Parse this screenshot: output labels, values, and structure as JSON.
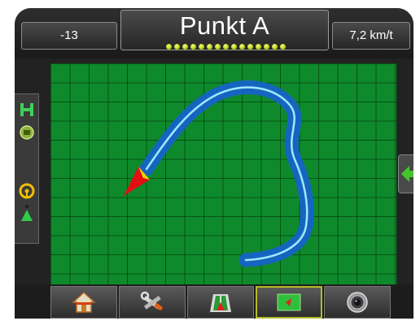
{
  "header": {
    "left_value": "-13",
    "title": "Punkt A",
    "right_value": "7,2 km/t",
    "indicator_count": 15,
    "indicator_color": "#c8e000"
  },
  "map": {
    "background_color": "#0e8a2c",
    "coverage_color": "#1565c0",
    "guideline_color": "#9fe8ff",
    "vehicle_color": "#e01010",
    "vehicle_accent": "#f2d200"
  },
  "sidebar": {
    "items": [
      {
        "icon": "guidance-lines-icon"
      },
      {
        "icon": "pattern-icon"
      },
      {
        "icon": "steering-wheel-icon"
      },
      {
        "icon": "vehicle-arrow-icon"
      }
    ]
  },
  "right_tab": {
    "icon": "green-arrow-left-icon"
  },
  "bottom_nav": {
    "items": [
      {
        "icon": "home-icon",
        "active": false
      },
      {
        "icon": "tools-icon",
        "active": false
      },
      {
        "icon": "vehicle-view-icon",
        "active": false
      },
      {
        "icon": "field-view-icon",
        "active": true
      },
      {
        "icon": "camera-icon",
        "active": false
      }
    ]
  }
}
